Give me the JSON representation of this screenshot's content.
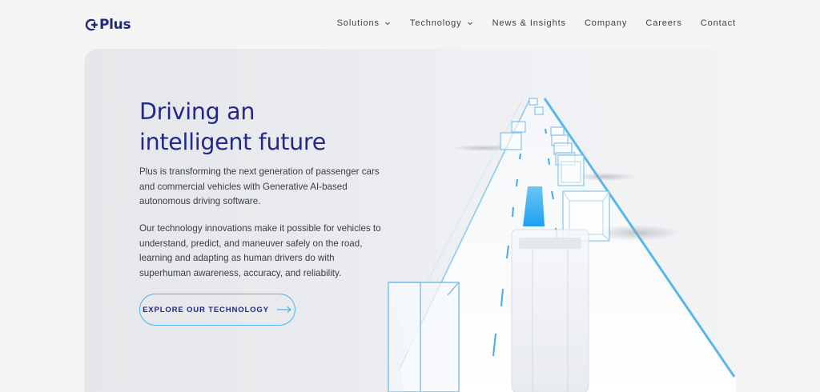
{
  "brand": {
    "name": "Plus",
    "color": "#1f2a7a"
  },
  "nav": {
    "items": [
      {
        "label": "Solutions",
        "has_dropdown": true
      },
      {
        "label": "Technology",
        "has_dropdown": true
      },
      {
        "label": "News & Insights",
        "has_dropdown": false
      },
      {
        "label": "Company",
        "has_dropdown": false
      },
      {
        "label": "Careers",
        "has_dropdown": false
      },
      {
        "label": "Contact",
        "has_dropdown": false
      }
    ]
  },
  "hero": {
    "title_line1": "Driving an",
    "title_line2": "intelligent future",
    "paragraph1": "Plus is transforming the next generation of passenger cars and commercial vehicles with Generative AI-based autonomous driving software.",
    "paragraph2": "Our technology innovations make it possible for vehicles to understand, predict, and maneuver safely on the road, learning and adapting as human drivers do with superhuman awareness, accuracy, and reliability.",
    "cta_label": "EXPLORE OUR TECHNOLOGY",
    "cta_icon": "arrow-right-icon"
  },
  "colors": {
    "title": "#23298a",
    "accent": "#4db4ec",
    "highlight_lane": "#29a9f2",
    "background": "#f5f5f6"
  }
}
